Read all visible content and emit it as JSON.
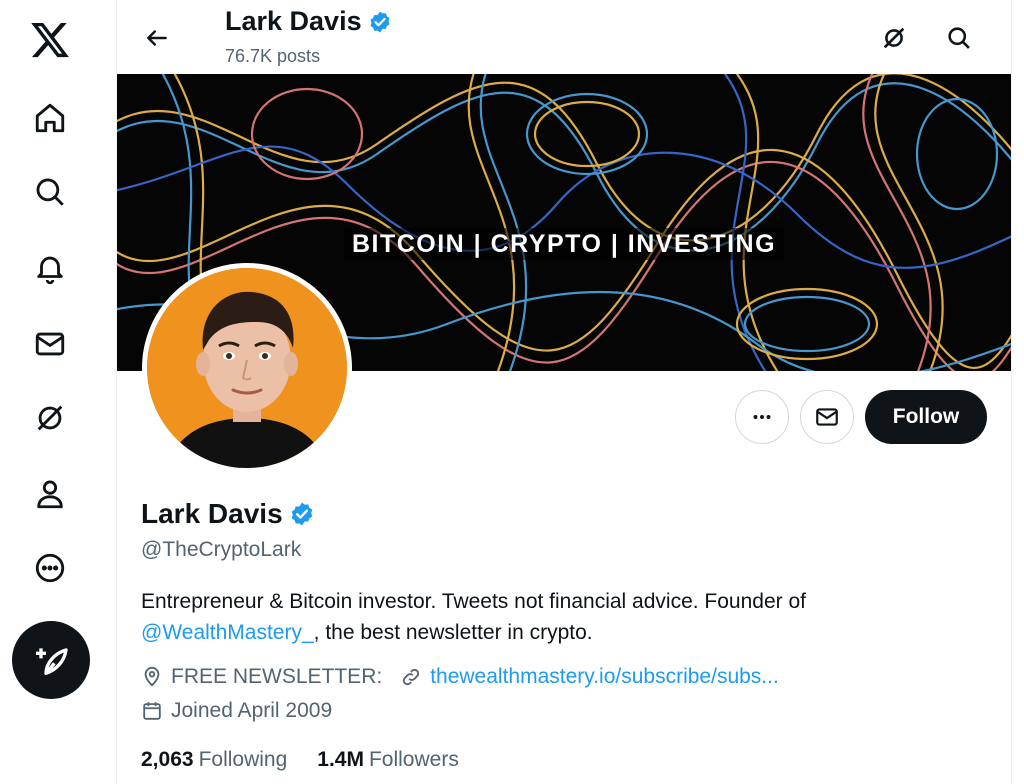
{
  "nav": {
    "items": [
      {
        "name": "x-logo",
        "label": "X"
      },
      {
        "name": "home",
        "label": "Home"
      },
      {
        "name": "explore",
        "label": "Explore"
      },
      {
        "name": "notifications",
        "label": "Notifications"
      },
      {
        "name": "messages",
        "label": "Messages"
      },
      {
        "name": "grok",
        "label": "Grok"
      },
      {
        "name": "profile",
        "label": "Profile"
      },
      {
        "name": "more",
        "label": "More"
      }
    ],
    "post_label": "Post"
  },
  "header": {
    "name": "Lark Davis",
    "posts": "76.7K posts"
  },
  "banner": {
    "text": "BITCOIN | CRYPTO | INVESTING"
  },
  "profile": {
    "display_name": "Lark Davis",
    "handle": "@TheCryptoLark",
    "bio_before": "Entrepreneur & Bitcoin investor. Tweets not financial advice. Founder of ",
    "bio_mention": "@WealthMastery_",
    "bio_after": ", the best newsletter in crypto.",
    "location": "FREE NEWSLETTER:",
    "website": "thewealthmastery.io/subscribe/subs...",
    "joined": "Joined April 2009",
    "following_count": "2,063",
    "following_label": "Following",
    "followers_count": "1.4M",
    "followers_label": "Followers"
  },
  "actions": {
    "follow_label": "Follow"
  },
  "colors": {
    "accent": "#1d9bf0",
    "text_primary": "#0f1419",
    "text_secondary": "#536471",
    "avatar_bg": "#f0921e"
  }
}
